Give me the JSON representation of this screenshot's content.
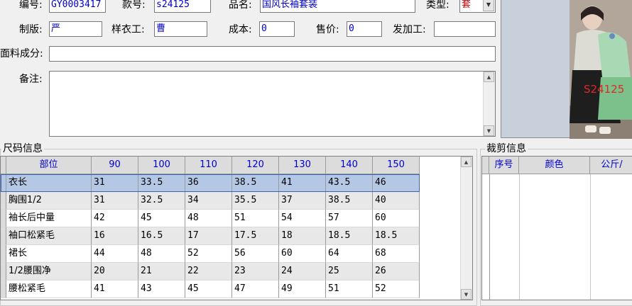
{
  "form": {
    "code_label": "编号:",
    "code_value": "GY0003417",
    "style_label": "款号:",
    "style_value": "s24125",
    "name_label": "品名:",
    "name_value": "国风长袖套装",
    "type_label": "类型:",
    "type_value": "套",
    "pattern_label": "制版:",
    "pattern_value": "严",
    "sampler_label": "样衣工:",
    "sampler_value": "曹",
    "cost_label": "成本:",
    "cost_value": "0",
    "price_label": "售价:",
    "price_value": "0",
    "processor_label": "发加工:",
    "processor_value": "",
    "fabric_label": "面料成分:",
    "fabric_value": "",
    "remark_label": "备注:",
    "remark_value": ""
  },
  "photo": {
    "overlay_text": "S24125"
  },
  "size_info": {
    "title": "尺码信息",
    "columns": [
      "部位",
      "90",
      "100",
      "110",
      "120",
      "130",
      "140",
      "150"
    ],
    "rows": [
      [
        "衣长",
        "31",
        "33.5",
        "36",
        "38.5",
        "41",
        "43.5",
        "46"
      ],
      [
        "胸围1/2",
        "31",
        "32.5",
        "34",
        "35.5",
        "37",
        "38.5",
        "40"
      ],
      [
        "袖长后中量",
        "42",
        "45",
        "48",
        "51",
        "54",
        "57",
        "60"
      ],
      [
        "袖口松紧毛",
        "16",
        "16.5",
        "17",
        "17.5",
        "18",
        "18.5",
        "18.5"
      ],
      [
        "裙长",
        "44",
        "48",
        "52",
        "56",
        "60",
        "64",
        "68"
      ],
      [
        "1/2腰围净",
        "20",
        "21",
        "22",
        "23",
        "24",
        "25",
        "26"
      ],
      [
        "腰松紧毛",
        "41",
        "43",
        "45",
        "47",
        "49",
        "51",
        "52"
      ]
    ]
  },
  "cut_info": {
    "title": "裁剪信息",
    "columns": [
      "序号",
      "颜色",
      "公斤/"
    ]
  }
}
